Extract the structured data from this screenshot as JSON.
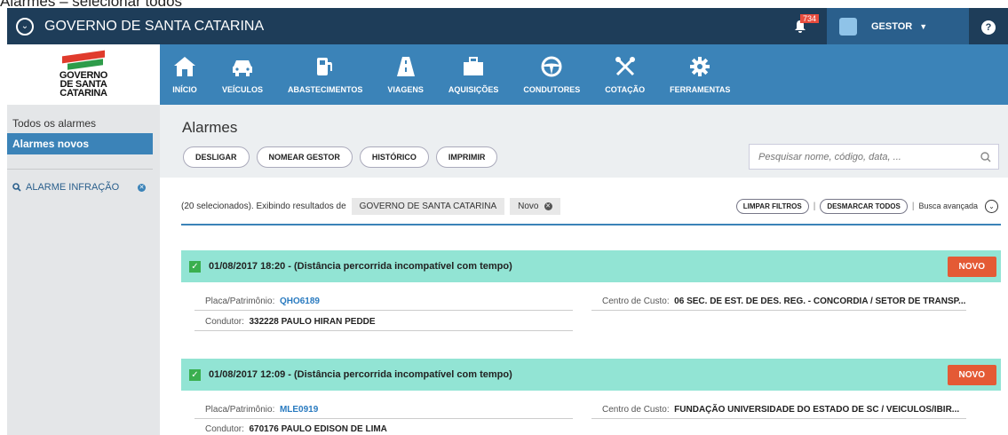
{
  "caption": "Alarmes – selecionar todos",
  "topbar": {
    "org": "GOVERNO DE SANTA CATARINA",
    "notifications": "734",
    "user": "GESTOR",
    "help": "?"
  },
  "brand": {
    "line1": "GOVERNO",
    "line2": "DE SANTA",
    "line3": "CATARINA"
  },
  "nav": [
    {
      "label": "INÍCIO",
      "icon": "home-icon"
    },
    {
      "label": "VEÍCULOS",
      "icon": "car-icon"
    },
    {
      "label": "ABASTECIMENTOS",
      "icon": "fuel-icon"
    },
    {
      "label": "VIAGENS",
      "icon": "road-icon"
    },
    {
      "label": "AQUISIÇÕES",
      "icon": "briefcase-icon"
    },
    {
      "label": "CONDUTORES",
      "icon": "steering-wheel-icon"
    },
    {
      "label": "COTAÇÃO",
      "icon": "tools-icon"
    },
    {
      "label": "FERRAMENTAS",
      "icon": "gear-icon"
    }
  ],
  "sidebar": {
    "all": "Todos os alarmes",
    "new": "Alarmes novos",
    "filter": "ALARME INFRAÇÃO"
  },
  "page": {
    "title": "Alarmes",
    "buttons": [
      "DESLIGAR",
      "NOMEAR GESTOR",
      "HISTÓRICO",
      "IMPRIMIR"
    ],
    "search_placeholder": "Pesquisar nome, código, data, ..."
  },
  "filters": {
    "summary": "(20 selecionados). Exibindo resultados de",
    "chip1": "GOVERNO DE SANTA CATARINA",
    "chip2": "Novo",
    "clear": "LIMPAR FILTROS",
    "unmark": "DESMARCAR TODOS",
    "sep": "|",
    "advanced": "Busca avançada"
  },
  "alarms": [
    {
      "title": "01/08/2017 18:20 - (Distância percorrida incompatível com tempo)",
      "badge": "NOVO",
      "plate_label": "Placa/Patrimônio:",
      "plate": "QHO6189",
      "driver_label": "Condutor:",
      "driver": "332228 PAULO HIRAN PEDDE",
      "cost_label": "Centro de Custo:",
      "cost": "06 SEC. DE EST. DE DES. REG. - CONCORDIA / SETOR DE TRANSP..."
    },
    {
      "title": "01/08/2017 12:09 - (Distância percorrida incompatível com tempo)",
      "badge": "NOVO",
      "plate_label": "Placa/Patrimônio:",
      "plate": "MLE0919",
      "driver_label": "Condutor:",
      "driver": "670176 PAULO EDISON DE LIMA",
      "cost_label": "Centro de Custo:",
      "cost": "FUNDAÇÃO UNIVERSIDADE DO ESTADO DE SC / VEICULOS/IBIR..."
    }
  ]
}
